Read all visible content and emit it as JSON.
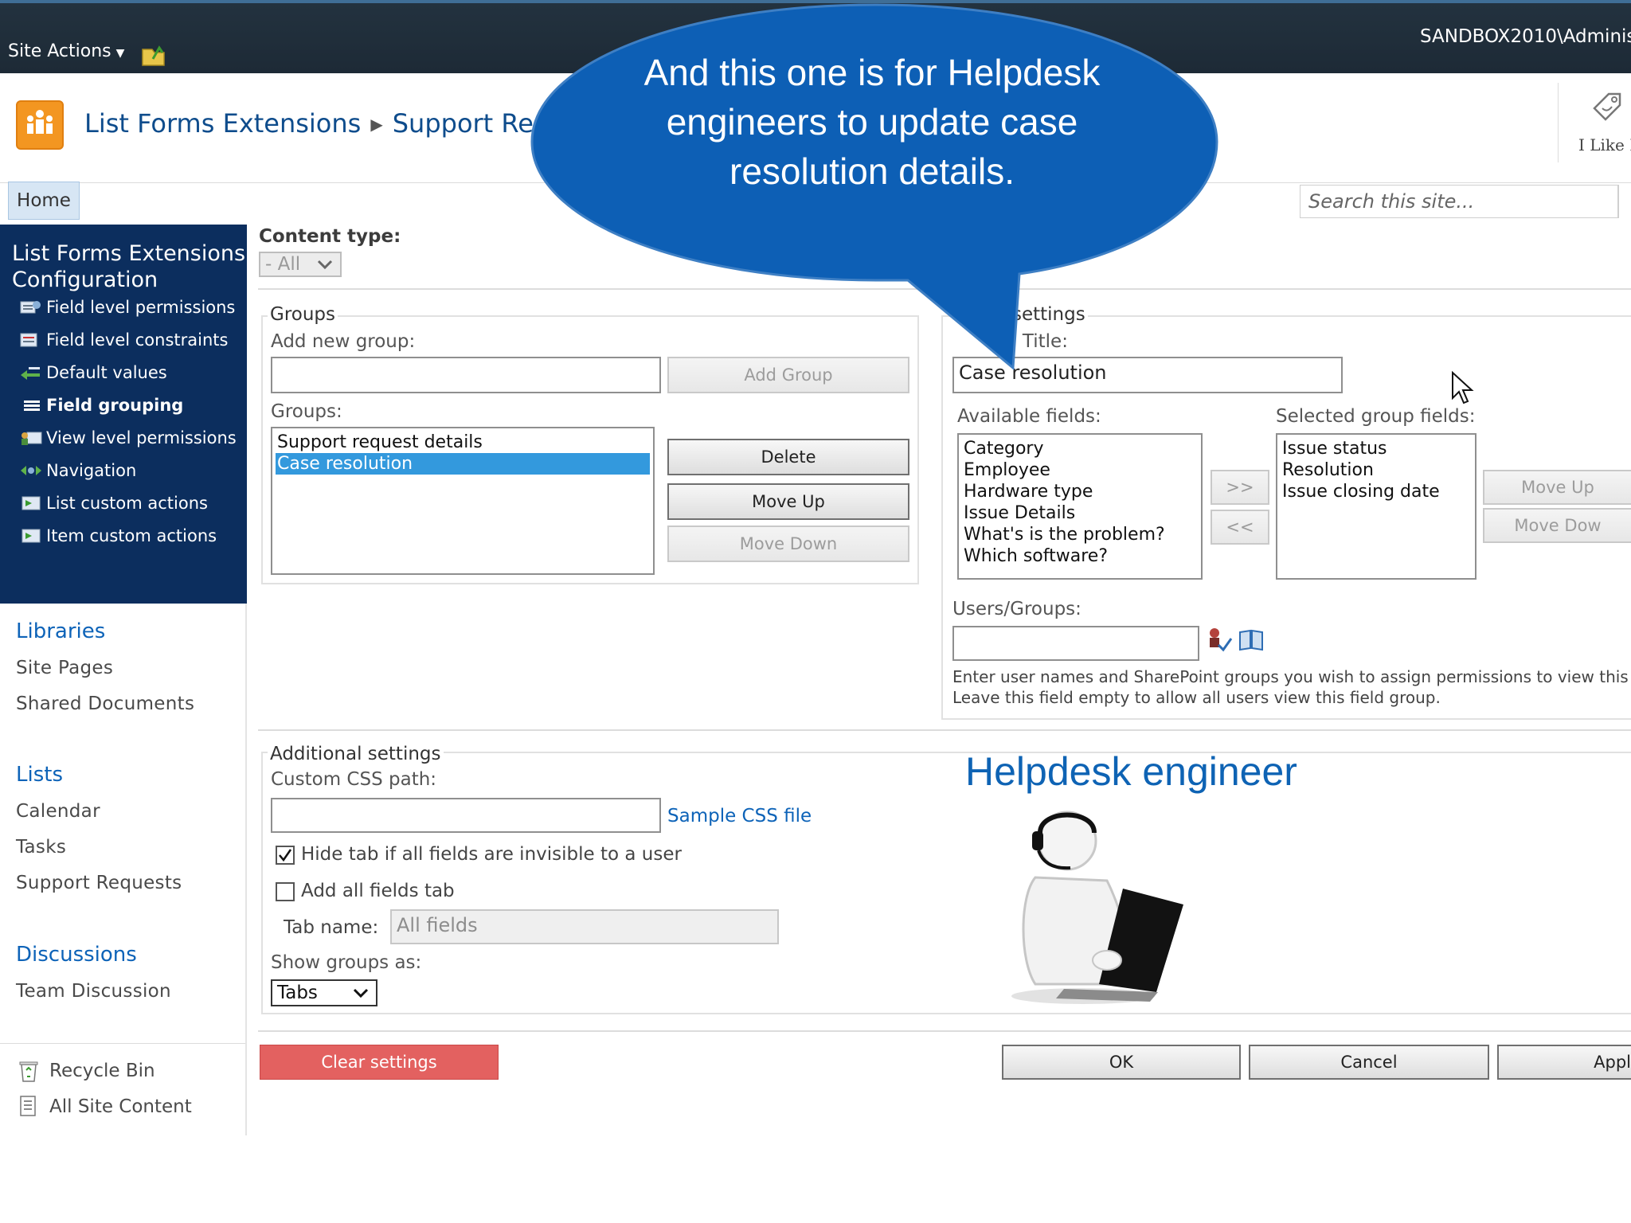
{
  "ribbon": {
    "site_actions": "Site Actions",
    "user": "SANDBOX2010\\Adminis"
  },
  "header": {
    "breadcrumb": [
      "List Forms Extensions",
      "Support Requ"
    ],
    "i_like_it": "I Like I"
  },
  "nav": {
    "home_tab": "Home",
    "search_placeholder": "Search this site..."
  },
  "config_nav": {
    "title": "List Forms Extensions Configuration",
    "items": [
      {
        "label": "Field level permissions",
        "icon": "permissions-icon"
      },
      {
        "label": "Field level constraints",
        "icon": "constraints-icon"
      },
      {
        "label": "Default values",
        "icon": "default-values-icon"
      },
      {
        "label": "Field grouping",
        "icon": "field-grouping-icon",
        "active": true
      },
      {
        "label": "View level permissions",
        "icon": "view-permissions-icon"
      },
      {
        "label": "Navigation",
        "icon": "navigation-icon"
      },
      {
        "label": "List custom actions",
        "icon": "list-actions-icon"
      },
      {
        "label": "Item custom actions",
        "icon": "item-actions-icon"
      }
    ]
  },
  "quick_launch": {
    "libraries_head": "Libraries",
    "libraries": [
      "Site Pages",
      "Shared Documents"
    ],
    "lists_head": "Lists",
    "lists": [
      "Calendar",
      "Tasks",
      "Support Requests"
    ],
    "discussions_head": "Discussions",
    "discussions": [
      "Team Discussion"
    ],
    "recycle_bin": "Recycle Bin",
    "all_site_content": "All Site Content"
  },
  "content_type": {
    "label": "Content type:",
    "value": "- All"
  },
  "groups": {
    "title": "Groups",
    "add_new_label": "Add new group:",
    "add_new_value": "",
    "add_button": "Add Group",
    "list_label": "Groups:",
    "items": [
      "Support request details",
      "Case resolution"
    ],
    "selected": 1,
    "delete_button": "Delete",
    "move_up_button": "Move Up",
    "move_down_button": "Move Down"
  },
  "group_settings": {
    "title_visible": "settings",
    "group_title_label": "p Title:",
    "group_title_value": "Case resolution",
    "available_label": "Available fields:",
    "available_fields": [
      "Category",
      "Employee",
      "Hardware type",
      "Issue Details",
      "What's is the problem?",
      "Which software?"
    ],
    "add_arrow": ">>",
    "remove_arrow": "<<",
    "selected_label": "Selected group fields:",
    "selected_fields": [
      "Issue status",
      "Resolution",
      "Issue closing date"
    ],
    "move_up": "Move Up",
    "move_down": "Move Dow",
    "users_label": "Users/Groups:",
    "users_value": "",
    "help_line1": "Enter user names and SharePoint groups you wish to assign permissions to view this field",
    "help_line2": "Leave this field empty to allow all users view this field group."
  },
  "additional": {
    "title": "Additional settings",
    "css_label": "Custom CSS path:",
    "css_value": "",
    "sample_link": "Sample CSS file",
    "hide_tab_label": "Hide tab if all fields are invisible to a user",
    "hide_tab_checked": true,
    "add_all_label": "Add all fields tab",
    "add_all_checked": false,
    "tab_name_label": "Tab name:",
    "tab_name_value": "All fields",
    "show_groups_label": "Show groups as:",
    "show_groups_value": "Tabs"
  },
  "footer": {
    "clear": "Clear settings",
    "ok": "OK",
    "cancel": "Cancel",
    "apply": "Appl"
  },
  "overlay": {
    "callout_text": "And this one is for Helpdesk engineers to update  case resolution details.",
    "callout_color": "#0d5fb5",
    "caption": "Helpdesk engineer"
  }
}
